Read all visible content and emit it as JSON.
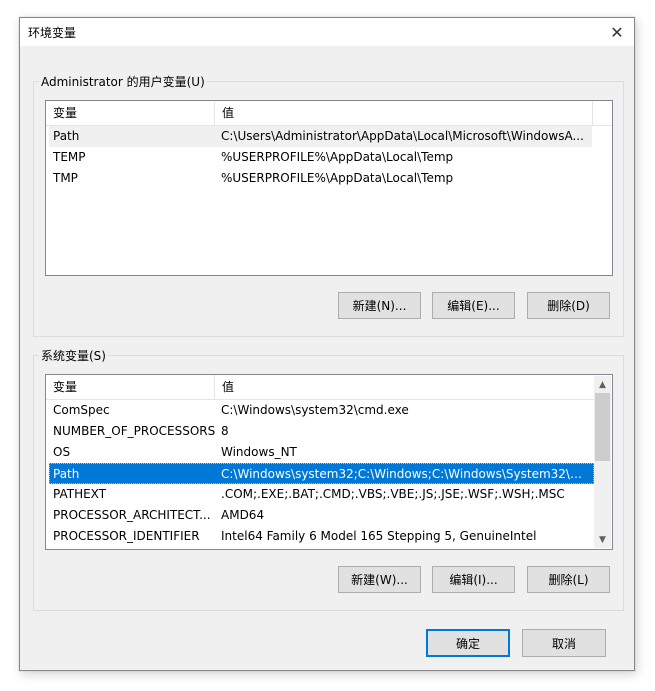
{
  "window": {
    "title": "环境变量",
    "close_glyph": "✕"
  },
  "user_group": {
    "label": "Administrator 的用户变量(U)",
    "columns": [
      "变量",
      "值"
    ],
    "rows": [
      {
        "name": "Path",
        "value": "C:\\Users\\Administrator\\AppData\\Local\\Microsoft\\WindowsA..."
      },
      {
        "name": "TEMP",
        "value": "%USERPROFILE%\\AppData\\Local\\Temp"
      },
      {
        "name": "TMP",
        "value": "%USERPROFILE%\\AppData\\Local\\Temp"
      }
    ],
    "buttons": {
      "new": "新建(N)...",
      "edit": "编辑(E)...",
      "delete": "删除(D)"
    }
  },
  "system_group": {
    "label": "系统变量(S)",
    "columns": [
      "变量",
      "值"
    ],
    "rows": [
      {
        "name": "ComSpec",
        "value": "C:\\Windows\\system32\\cmd.exe"
      },
      {
        "name": "NUMBER_OF_PROCESSORS",
        "value": "8"
      },
      {
        "name": "OS",
        "value": "Windows_NT"
      },
      {
        "name": "Path",
        "value": "C:\\Windows\\system32;C:\\Windows;C:\\Windows\\System32\\Wb..."
      },
      {
        "name": "PATHEXT",
        "value": ".COM;.EXE;.BAT;.CMD;.VBS;.VBE;.JS;.JSE;.WSF;.WSH;.MSC"
      },
      {
        "name": "PROCESSOR_ARCHITECT...",
        "value": "AMD64"
      },
      {
        "name": "PROCESSOR_IDENTIFIER",
        "value": "Intel64 Family 6 Model 165 Stepping 5, GenuineIntel"
      }
    ],
    "buttons": {
      "new": "新建(W)...",
      "edit": "编辑(I)...",
      "delete": "删除(L)"
    }
  },
  "footer": {
    "ok": "确定",
    "cancel": "取消"
  },
  "icons": {
    "scroll_up": "up-arrow-icon",
    "scroll_down": "down-arrow-icon",
    "close": "close-icon"
  },
  "colors": {
    "selection": "#0078d7",
    "dialog_bg": "#f0f0f0"
  }
}
